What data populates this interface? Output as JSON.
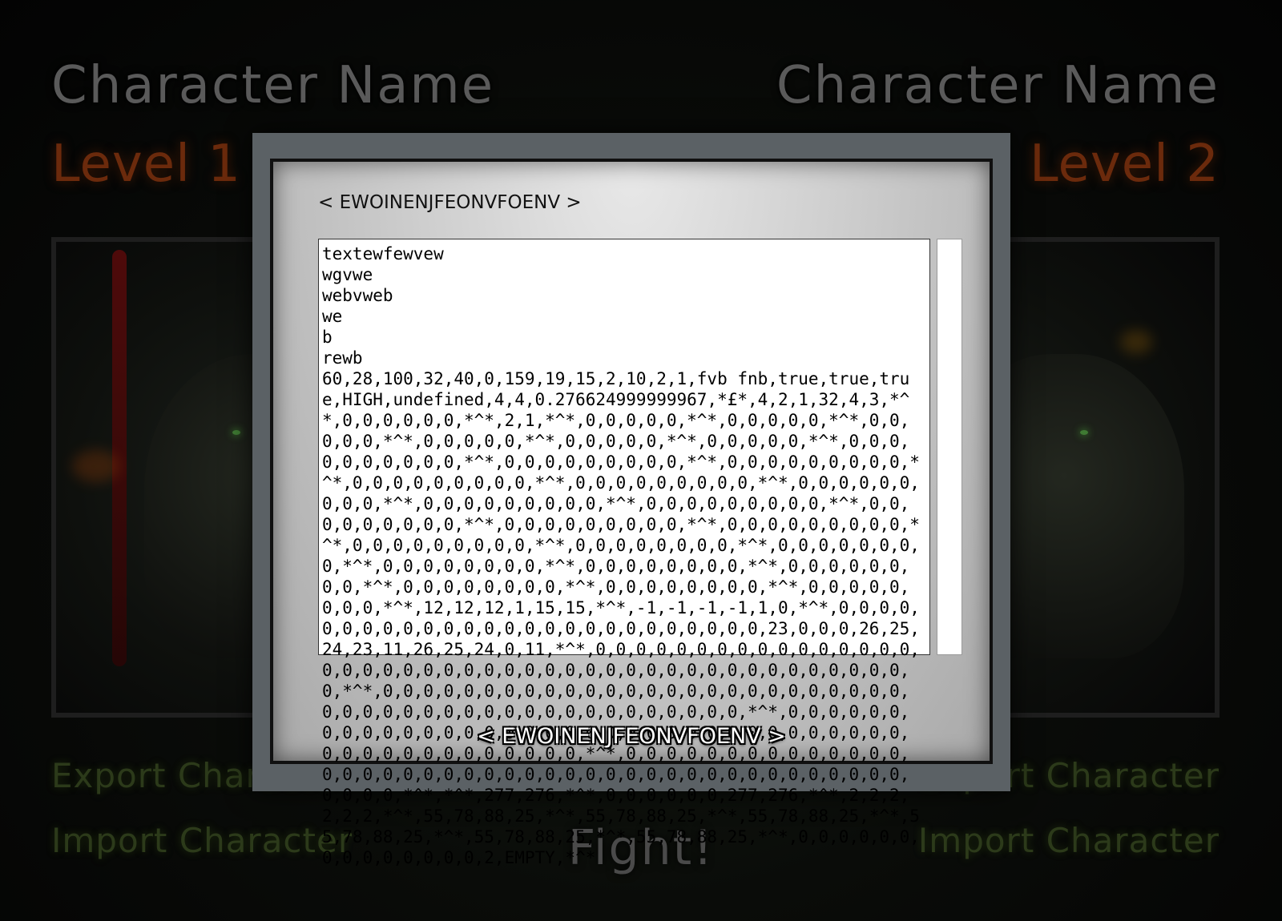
{
  "player1": {
    "name": "Character Name",
    "level": "Level 1",
    "export_label": "Export Character",
    "import_label": "Import Character"
  },
  "player2": {
    "name": "Character Name",
    "level": "Level 2",
    "export_label": "Export Character",
    "import_label": "Import Character"
  },
  "fight_label": "Fight!",
  "dialog": {
    "title": "< EWOINENJFEONVFOENV >",
    "text": "textewfewvew\nwgvwe\nwebvweb\nwe\nb\nrewb\n60,28,100,32,40,0,159,19,15,2,10,2,1,fvb fnb,true,true,true,HIGH,undefined,4,4,0.276624999999967,*£*,4,2,1,32,4,3,*^*,0,0,0,0,0,0,*^*,2,1,*^*,0,0,0,0,0,*^*,0,0,0,0,0,*^*,0,0,0,0,0,*^*,0,0,0,0,0,*^*,0,0,0,0,0,*^*,0,0,0,0,0,*^*,0,0,0,0,0,0,0,0,0,0,*^*,0,0,0,0,0,0,0,0,0,*^*,0,0,0,0,0,0,0,0,0,*^*,0,0,0,0,0,0,0,0,0,*^*,0,0,0,0,0,0,0,0,0,*^*,0,0,0,0,0,0,0,0,0,*^*,0,0,0,0,0,0,0,0,0,*^*,0,0,0,0,0,0,0,0,0,*^*,0,0,0,0,0,0,0,0,0,*^*,0,0,0,0,0,0,0,0,0,*^*,0,0,0,0,0,0,0,0,0,*^*,0,0,0,0,0,0,0,0,0,*^*,0,0,0,0,0,0,0,0,*^*,0,0,0,0,0,0,0,0,*^*,0,0,0,0,0,0,0,0,*^*,0,0,0,0,0,0,0,0,*^*,0,0,0,0,0,0,0,0,*^*,0,0,0,0,0,0,0,0,*^*,0,0,0,0,0,0,0,0,*^*,0,0,0,0,0,0,0,0,*^*,12,12,12,1,15,15,*^*,-1,-1,-1,-1,1,0,*^*,0,0,0,0,0,0,0,0,0,0,0,0,0,0,0,0,0,0,0,0,0,0,0,0,0,0,23,0,0,0,26,25,24,23,11,26,25,24,0,11,*^*,0,0,0,0,0,0,0,0,0,0,0,0,0,0,0,0,0,0,0,0,0,0,0,0,0,0,0,0,0,0,0,0,0,0,0,0,0,0,0,0,0,0,0,0,0,0,*^*,0,0,0,0,0,0,0,0,0,0,0,0,0,0,0,0,0,0,0,0,0,0,0,0,0,0,0,0,0,0,0,0,0,0,0,0,0,0,0,0,0,0,0,0,0,0,0,*^*,0,0,0,0,0,0,0,0,0,0,0,0,0,0,0,0,0,0,0,0,0,0,0,0,0,0,0,0,0,0,0,0,0,0,0,0,0,0,0,0,0,0,0,0,0,0,0,0,*^*,0,0,0,0,0,0,0,0,0,0,0,0,0,0,0,0,0,0,0,0,0,0,0,0,0,0,0,0,0,0,0,0,0,0,0,0,0,0,0,0,0,0,0,0,0,0,0,*^*,*^*,277,276,*^*,0,0,0,0,0,0,277,276,*^*,2,2,2,2,2,2,*^*,55,78,88,25,*^*,55,78,88,25,*^*,55,78,88,25,*^*,55,78,88,25,*^*,55,78,88,25,*^*,55,78,88,25,*^*,0,0,0,0,0,0,0,0,0,0,0,0,0,0,2,EMPTY,*^*",
    "button_label": "< EWOINENJFEONVFOENV >"
  },
  "colors": {
    "dialog_frame": "#5b6165",
    "level_text": "#6b2a0c",
    "side_button_text": "#2c3a1a"
  }
}
